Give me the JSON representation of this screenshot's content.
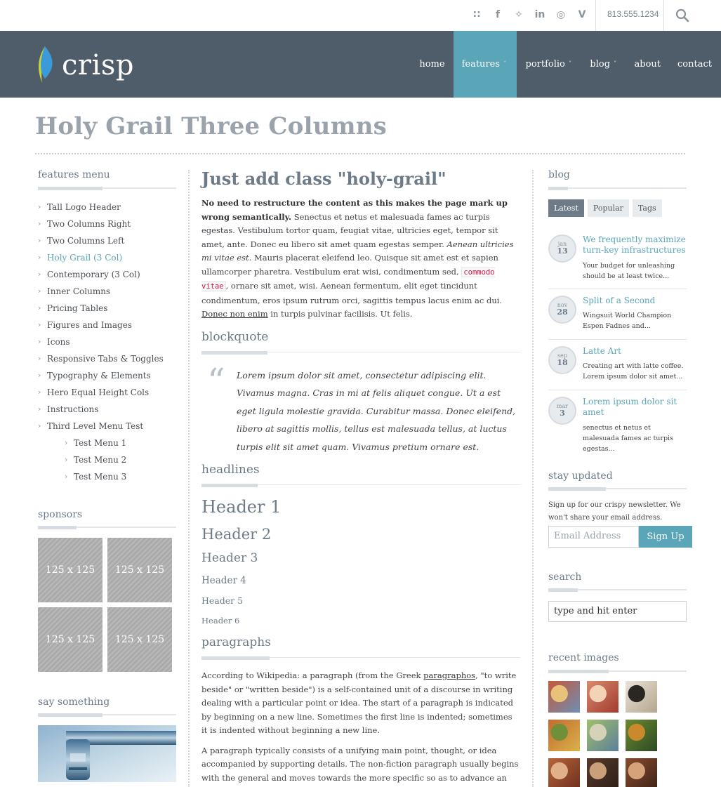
{
  "topbar": {
    "social": [
      {
        "icon": "rss-icon",
        "glyph": "∷"
      },
      {
        "icon": "facebook-icon",
        "glyph": "f"
      },
      {
        "icon": "twitter-icon",
        "glyph": "✧"
      },
      {
        "icon": "linkedin-icon",
        "glyph": "in"
      },
      {
        "icon": "dribbble-icon",
        "glyph": "◎"
      },
      {
        "icon": "vimeo-icon",
        "glyph": "V"
      }
    ],
    "phone": "813.555.1234",
    "search_icon": "search-icon"
  },
  "header": {
    "logo_text": "crisp",
    "nav": [
      {
        "label": "home",
        "dropdown": false,
        "active": false
      },
      {
        "label": "features",
        "dropdown": true,
        "active": true
      },
      {
        "label": "portfolio",
        "dropdown": true,
        "active": false
      },
      {
        "label": "blog",
        "dropdown": true,
        "active": false
      },
      {
        "label": "about",
        "dropdown": false,
        "active": false
      },
      {
        "label": "contact",
        "dropdown": false,
        "active": false
      }
    ],
    "caret": "˅"
  },
  "page_title": "Holy Grail Three Columns",
  "left": {
    "menu_title": "features menu",
    "arrow": "›",
    "menu": [
      {
        "label": "Tall Logo Header"
      },
      {
        "label": "Two Columns Right"
      },
      {
        "label": "Two Columns Left"
      },
      {
        "label": "Holy Grail (3 Col)",
        "active": true
      },
      {
        "label": "Contemporary (3 Col)"
      },
      {
        "label": "Inner Columns"
      },
      {
        "label": "Pricing Tables"
      },
      {
        "label": "Figures and Images"
      },
      {
        "label": "Icons"
      },
      {
        "label": "Responsive Tabs & Toggles"
      },
      {
        "label": "Typography & Elements"
      },
      {
        "label": "Hero Equal Height Cols"
      },
      {
        "label": "Instructions"
      },
      {
        "label": "Third Level Menu Test"
      },
      {
        "label": "Test Menu 1",
        "sub": true
      },
      {
        "label": "Test Menu 2",
        "sub": true
      },
      {
        "label": "Test Menu 3",
        "sub": true
      }
    ],
    "sponsors_title": "sponsors",
    "sponsors": [
      "125 x 125",
      "125 x 125",
      "125 x 125",
      "125 x 125"
    ],
    "say_title": "say something"
  },
  "center": {
    "heading": "Just add class \"holy-grail\"",
    "intro_bold": "No need to restructure the content as this makes the page mark up wrong semantically.",
    "intro_1": " Senectus et netus et malesuada fames ac turpis egestas. Vestibulum tortor quam, feugiat vitae, ultricies eget, tempor sit amet, ante. Donec eu libero sit amet quam egestas semper. ",
    "intro_italic": "Aenean ultricies mi vitae est.",
    "intro_2": " Mauris placerat eleifend leo. Quisque sit amet est et sapien ullamcorper pharetra. Vestibulum erat wisi, condimentum sed, ",
    "intro_code": "commodo vitae",
    "intro_3": ", ornare sit amet, wisi. Aenean fermentum, elit eget tincidunt condimentum, eros ipsum rutrum orci, sagittis tempus lacus enim ac dui. ",
    "intro_link": "Donec non enim",
    "intro_4": " in turpis pulvinar facilisis. Ut felis.",
    "blockquote_title": "blockquote",
    "quote_mark": "“",
    "blockquote": "Lorem ipsum dolor sit amet, consectetur adipiscing elit. Vivamus magna. Cras in mi at felis aliquet congue. Ut a est eget ligula molestie gravida. Curabitur massa. Donec eleifend, libero at sagittis mollis, tellus est malesuada tellus, at luctus turpis elit sit amet quam. Vivamus pretium ornare est.",
    "headlines_title": "headlines",
    "headers": [
      "Header 1",
      "Header 2",
      "Header 3",
      "Header 4",
      "Header 5",
      "Header 6"
    ],
    "paragraphs_title": "paragraphs",
    "para1_a": "According to Wikipedia: a paragraph (from the Greek ",
    "para1_link": "paragraphos",
    "para1_b": ", \"to write beside\" or \"written beside\") is a self-contained unit of a discourse in writing dealing with a particular point or idea. The start of a paragraph is indicated by beginning on a new line. Sometimes the first line is indented; sometimes it is indented without beginning a new line.",
    "para2": "A paragraph typically consists of a unifying main point, thought, or idea accompanied by supporting details. The non-fiction paragraph usually begins with the general and moves towards the more specific so as to advance an argument or"
  },
  "right": {
    "blog_title": "blog",
    "tabs": [
      {
        "label": "Latest",
        "active": true
      },
      {
        "label": "Popular",
        "active": false
      },
      {
        "label": "Tags",
        "active": false
      }
    ],
    "posts": [
      {
        "month": "jan",
        "day": "13",
        "title": "We frequently maximize turn-key infrastructures",
        "excerpt": "Your budget for unleashing should be at least twice..."
      },
      {
        "month": "nov",
        "day": "28",
        "title": "Split of a Second",
        "excerpt": "Wingsuit World Champion Espen Fadnes and..."
      },
      {
        "month": "sep",
        "day": "18",
        "title": "Latte Art",
        "excerpt": "Creating art with latte coffee. Lorem ipsum dolor sit amet..."
      },
      {
        "month": "mar",
        "day": "3",
        "title": "Lorem ipsum dolor sit amet",
        "excerpt": "senectus et netus et malesuada fames ac turpis egestas..."
      }
    ],
    "stay_title": "stay updated",
    "newsletter_text": "Sign up for our crispy newsletter. We won't share your email address.",
    "email_placeholder": "Email Address",
    "signup_label": "Sign Up",
    "search_title": "search",
    "search_value": "type and hit enter",
    "recent_title": "recent images",
    "recent_images": [
      "painting-thumbnail",
      "painting-thumbnail",
      "painting-thumbnail",
      "painting-thumbnail",
      "painting-thumbnail",
      "painting-thumbnail",
      "painting-thumbnail",
      "painting-thumbnail",
      "painting-thumbnail"
    ]
  },
  "colors": {
    "header_bg": "#4f5d6b",
    "accent": "#5aa5b8",
    "heading": "#6d7b89",
    "title": "#9aa3ac"
  }
}
